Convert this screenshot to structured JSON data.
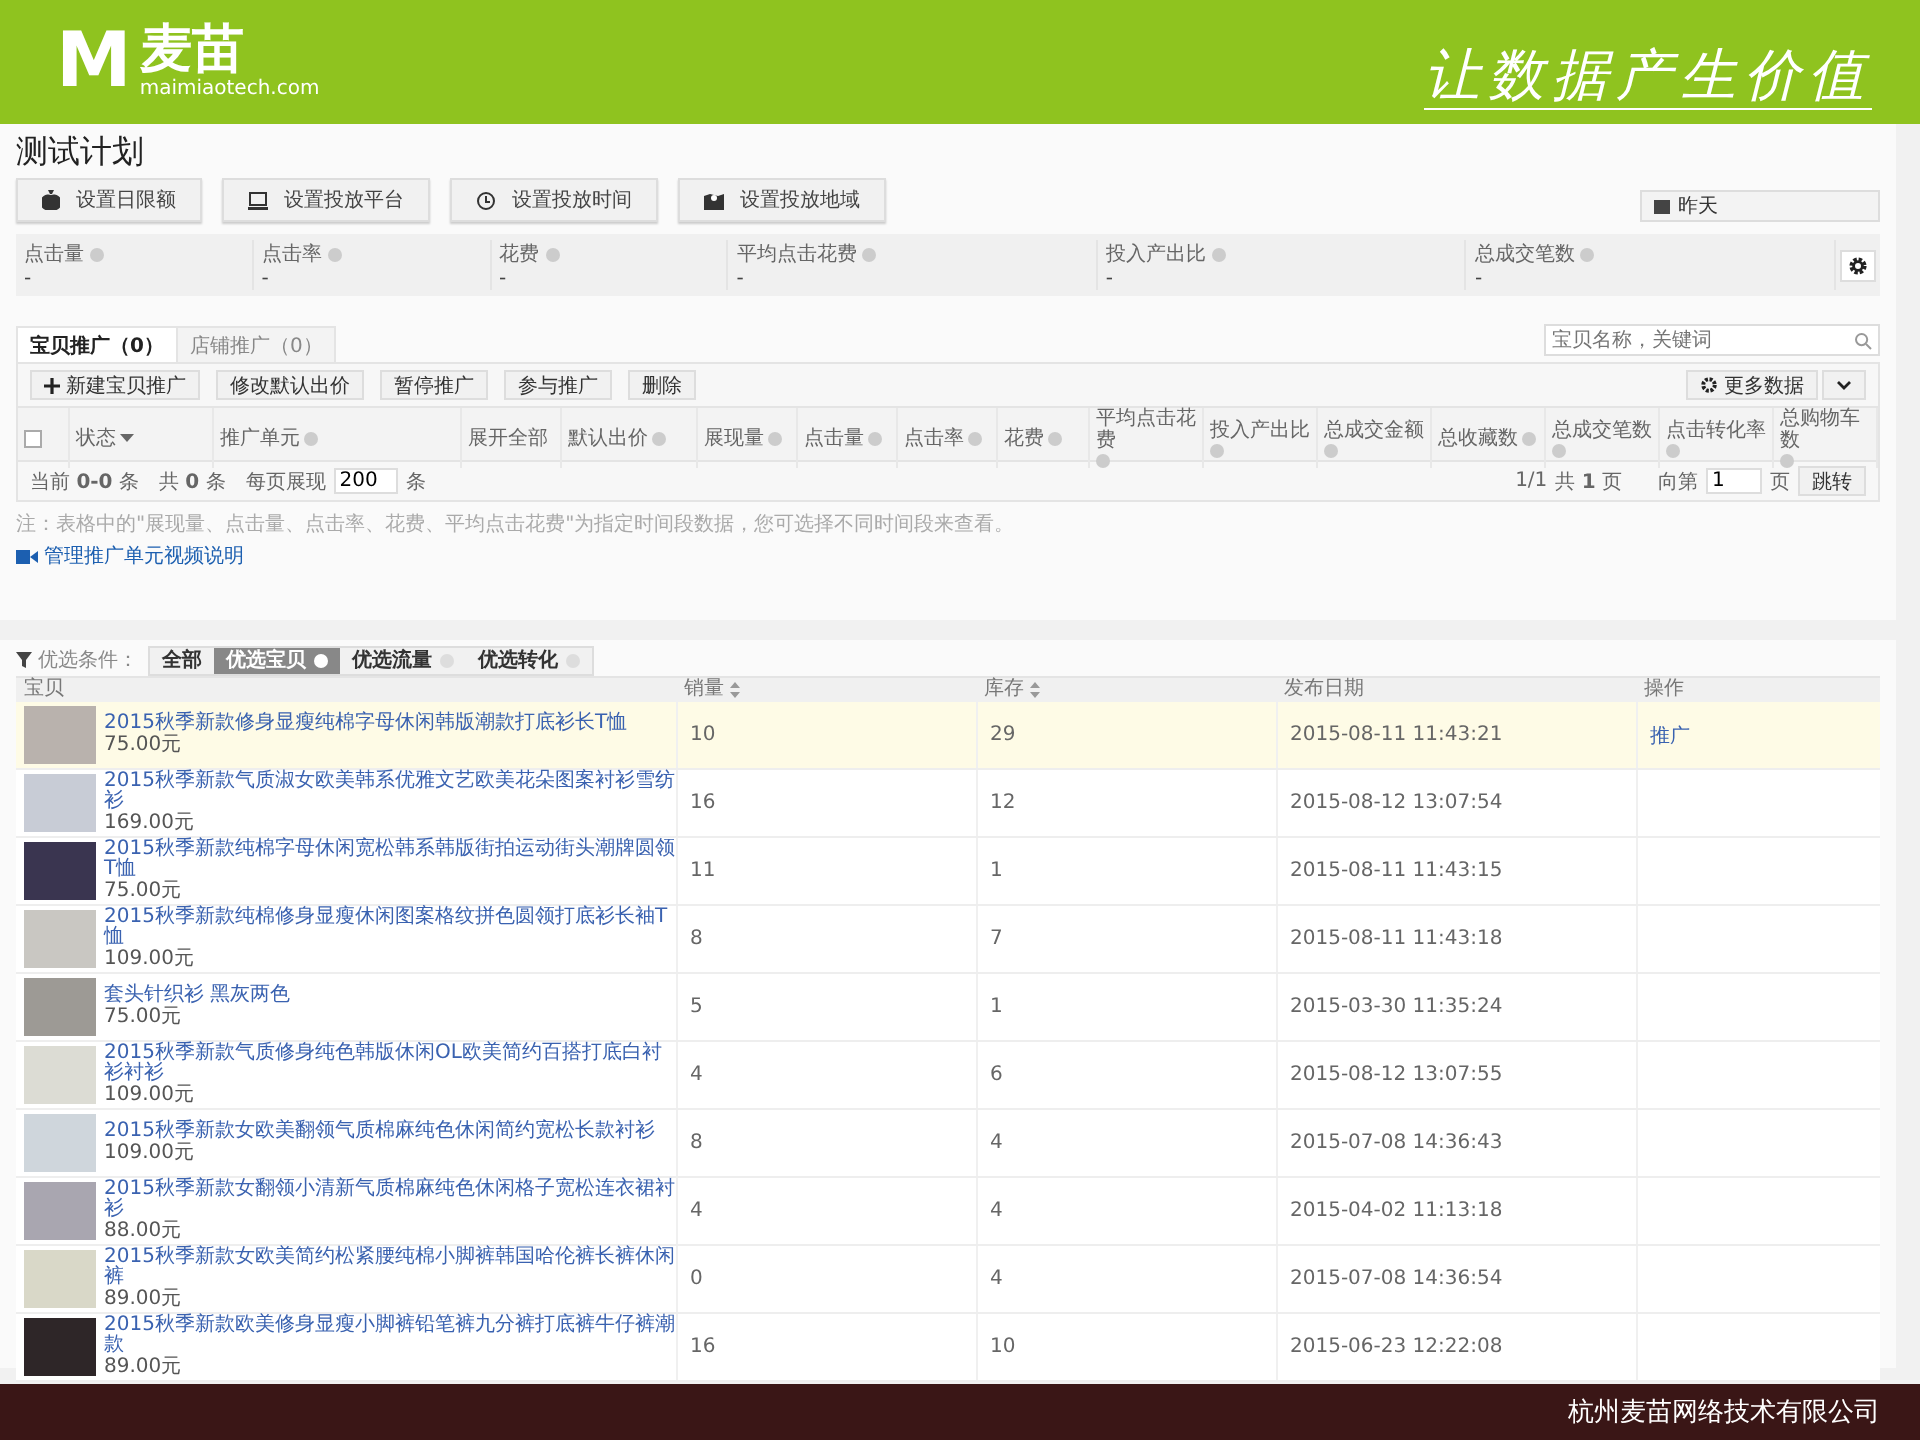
{
  "header": {
    "logo_mark": "M",
    "logo_text": "麦苗",
    "logo_domain": "maimiaotech.com",
    "slogan": "让数据产生价值"
  },
  "plan": {
    "title": "测试计划",
    "buttons": [
      {
        "label": "设置日限额",
        "kind": "money"
      },
      {
        "label": "设置投放平台",
        "kind": "monitor"
      },
      {
        "label": "设置投放时间",
        "kind": "clock"
      },
      {
        "label": "设置投放地域",
        "kind": "map"
      }
    ],
    "date_select": "昨天",
    "metrics": [
      {
        "label": "点击量",
        "value": "-"
      },
      {
        "label": "点击率",
        "value": "-"
      },
      {
        "label": "花费",
        "value": "-"
      },
      {
        "label": "平均点击花费",
        "value": "-"
      },
      {
        "label": "投入产出比",
        "value": "-"
      },
      {
        "label": "总成交笔数",
        "value": "-"
      }
    ],
    "tabs": [
      {
        "label": "宝贝推广（0）",
        "selected": true
      },
      {
        "label": "店铺推广（0）",
        "selected": false
      }
    ],
    "search": {
      "placeholder": "宝贝名称，关键词"
    },
    "actions": [
      {
        "label": "新建宝贝推广",
        "kind": "add"
      },
      {
        "label": "修改默认出价",
        "kind": "plain"
      },
      {
        "label": "暂停推广",
        "kind": "plain"
      },
      {
        "label": "参与推广",
        "kind": "plain"
      },
      {
        "label": "删除",
        "kind": "plain"
      }
    ],
    "more_button": "更多数据",
    "columns": [
      {
        "kind": "checkbox",
        "checked": false
      },
      {
        "label": "状态",
        "kind": "dropdown"
      },
      {
        "label": "推广单元",
        "kind": "help"
      },
      {
        "label": "展开全部",
        "kind": "plain"
      },
      {
        "label": "默认出价",
        "kind": "help"
      },
      {
        "label": "展现量",
        "kind": "help"
      },
      {
        "label": "点击量",
        "kind": "help"
      },
      {
        "label": "点击率",
        "kind": "help"
      },
      {
        "label": "花费",
        "kind": "help"
      },
      {
        "label": "平均点击花费",
        "kind": "help"
      },
      {
        "label": "投入产出比",
        "kind": "help"
      },
      {
        "label": "总成交金额",
        "kind": "help"
      },
      {
        "label": "总收藏数",
        "kind": "help"
      },
      {
        "label": "总成交笔数",
        "kind": "help"
      },
      {
        "label": "点击转化率",
        "kind": "help"
      },
      {
        "label": "总购物车数",
        "kind": "help"
      }
    ],
    "pagination": {
      "summary": "当前 **0-0** 条　共 **0** 条　每页展现",
      "page_size": "200",
      "unit": "条",
      "pages": "1/1",
      "total": "共 **1** 页",
      "goto_label": "向第",
      "page": "1",
      "page_unit": "页",
      "jump": "跳转"
    },
    "note": "注：表格中的\"展现量、点击量、点击率、花费、平均点击花费\"为指定时间段数据，您可选择不同时间段来查看。",
    "video_link": "管理推广单元视频说明"
  },
  "products": {
    "filter_label": "优选条件：",
    "filters": [
      {
        "label": "全部",
        "selected": false,
        "toggle": false
      },
      {
        "label": "优选宝贝",
        "selected": true,
        "toggle": true
      },
      {
        "label": "优选流量",
        "selected": false,
        "toggle": true
      },
      {
        "label": "优选转化",
        "selected": false,
        "toggle": true
      }
    ],
    "columns": [
      {
        "label": "宝贝",
        "sortable": false
      },
      {
        "label": "销量",
        "sortable": true
      },
      {
        "label": "库存",
        "sortable": true
      },
      {
        "label": "发布日期",
        "sortable": false
      },
      {
        "label": "操作",
        "sortable": false
      }
    ],
    "rows": [
      {
        "title": "2015秋季新款修身显瘦纯棉字母休闲韩版潮款打底衫长T恤",
        "price": "75.00元",
        "sales": "10",
        "stock": "29",
        "date": "2015-08-11 11:43:21",
        "action": "推广",
        "selected": true
      },
      {
        "title": "2015秋季新款气质淑女欧美韩系优雅文艺欧美花朵图案衬衫雪纺衫",
        "price": "169.00元",
        "sales": "16",
        "stock": "12",
        "date": "2015-08-12 13:07:54",
        "action": "",
        "selected": false
      },
      {
        "title": "2015秋季新款纯棉字母休闲宽松韩系韩版街拍运动街头潮牌圆领T恤",
        "price": "75.00元",
        "sales": "11",
        "stock": "1",
        "date": "2015-08-11 11:43:15",
        "action": "",
        "selected": false
      },
      {
        "title": "2015秋季新款纯棉修身显瘦休闲图案格纹拼色圆领打底衫长袖T恤",
        "price": "109.00元",
        "sales": "8",
        "stock": "7",
        "date": "2015-08-11 11:43:18",
        "action": "",
        "selected": false
      },
      {
        "title": "套头针织衫 黑灰两色",
        "price": "75.00元",
        "sales": "5",
        "stock": "1",
        "date": "2015-03-30 11:35:24",
        "action": "",
        "selected": false
      },
      {
        "title": "2015秋季新款气质修身纯色韩版休闲OL欧美简约百搭打底白衬衫衬衫",
        "price": "109.00元",
        "sales": "4",
        "stock": "6",
        "date": "2015-08-12 13:07:55",
        "action": "",
        "selected": false
      },
      {
        "title": "2015秋季新款女欧美翻领气质棉麻纯色休闲简约宽松长款衬衫",
        "price": "109.00元",
        "sales": "8",
        "stock": "4",
        "date": "2015-07-08 14:36:43",
        "action": "",
        "selected": false
      },
      {
        "title": "2015秋季新款女翻领小清新气质棉麻纯色休闲格子宽松连衣裙衬衫",
        "price": "88.00元",
        "sales": "4",
        "stock": "4",
        "date": "2015-04-02 11:13:18",
        "action": "",
        "selected": false
      },
      {
        "title": "2015秋季新款女欧美简约松紧腰纯棉小脚裤韩国哈伦裤长裤休闲裤",
        "price": "89.00元",
        "sales": "0",
        "stock": "4",
        "date": "2015-07-08 14:36:54",
        "action": "",
        "selected": false
      },
      {
        "title": "2015秋季新款欧美修身显瘦小脚裤铅笔裤九分裤打底裤牛仔裤潮款",
        "price": "89.00元",
        "sales": "16",
        "stock": "10",
        "date": "2015-06-23 12:22:08",
        "action": "",
        "selected": false
      }
    ]
  },
  "footer": {
    "company": "杭州麦苗网络技术有限公司"
  }
}
